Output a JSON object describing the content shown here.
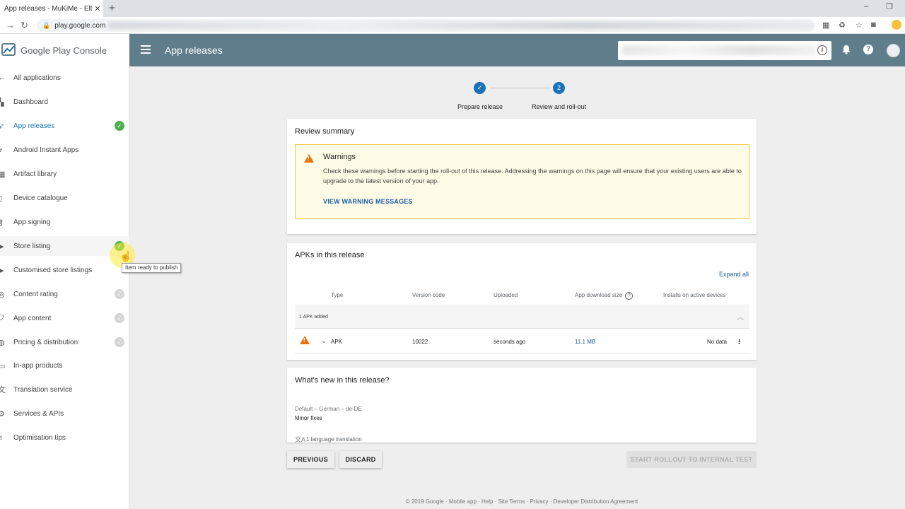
{
  "browser": {
    "tab_title": "App releases - MuKiMe - Eltern",
    "tab_close": "✕",
    "new_tab": "+",
    "url": "play.google.com"
  },
  "app": {
    "brand_google": "Google Play",
    "brand_console": "Console",
    "page_title": "App releases"
  },
  "sidebar": {
    "items": [
      {
        "label": "All applications",
        "icon": "back-arrow-icon",
        "status": "none"
      },
      {
        "label": "Dashboard",
        "icon": "dashboard-icon",
        "status": "none"
      },
      {
        "label": "App releases",
        "icon": "rocket-icon",
        "status": "done",
        "active": true
      },
      {
        "label": "Android Instant Apps",
        "icon": "lightning-icon",
        "status": "none"
      },
      {
        "label": "Artifact library",
        "icon": "library-icon",
        "status": "none"
      },
      {
        "label": "Device catalogue",
        "icon": "device-icon",
        "status": "none"
      },
      {
        "label": "App signing",
        "icon": "key-icon",
        "status": "none"
      },
      {
        "label": "Store listing",
        "icon": "store-icon",
        "status": "done"
      },
      {
        "label": "Customised store listings",
        "icon": "store-custom-icon",
        "status": "none"
      },
      {
        "label": "Content rating",
        "icon": "rating-icon",
        "status": "pending"
      },
      {
        "label": "App content",
        "icon": "shield-icon",
        "status": "pending"
      },
      {
        "label": "Pricing & distribution",
        "icon": "globe-icon",
        "status": "pending"
      },
      {
        "label": "In-app products",
        "icon": "cart-icon",
        "status": "none"
      },
      {
        "label": "Translation service",
        "icon": "translate-icon",
        "status": "none"
      },
      {
        "label": "Services & APIs",
        "icon": "api-icon",
        "status": "none"
      },
      {
        "label": "Optimisation tips",
        "icon": "bulb-icon",
        "status": "none"
      }
    ],
    "tooltip": "Item ready to publish"
  },
  "stepper": {
    "steps": [
      {
        "label": "Prepare release",
        "glyph": "✓"
      },
      {
        "label": "Review and roll-out",
        "glyph": "2"
      }
    ]
  },
  "review": {
    "title": "Review summary",
    "warning_heading": "Warnings",
    "warning_text": "Check these warnings before starting the roll-out of this release. Addressing the warnings on this page will ensure that your existing users are able to upgrade to the latest version of your app.",
    "warning_link": "VIEW WARNING MESSAGES"
  },
  "apks": {
    "title": "APKs in this release",
    "expand_all": "Expand all",
    "columns": [
      "Type",
      "Version code",
      "Uploaded",
      "App download size",
      "Installs on active devices"
    ],
    "group_label": "1 APK added",
    "rows": [
      {
        "type": "APK",
        "version_code": "10022",
        "uploaded": "seconds ago",
        "size": "11.1 MB",
        "installs": "No data"
      }
    ]
  },
  "whats_new": {
    "title": "What's new in this release?",
    "locale": "Default – German – de-DE",
    "text": "Minor fixes",
    "translations": "1 language translation"
  },
  "buttons": {
    "previous": "PREVIOUS",
    "discard": "DISCARD",
    "rollout": "START ROLLOUT TO INTERNAL TEST"
  },
  "footer": {
    "text": "© 2019 Google · Mobile app · Help · Site Terms · Privacy · Developer Distribution Agreement"
  },
  "colors": {
    "appbar": "#607d8b",
    "accent": "#1a73b8",
    "success": "#4caf50",
    "warning": "#e8710a"
  }
}
